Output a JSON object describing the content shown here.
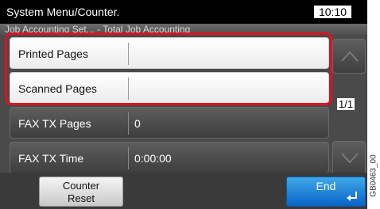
{
  "header": {
    "title": "System Menu/Counter.",
    "time": "10:10"
  },
  "breadcrumb": "Job Accounting Set... - Total Job Accounting",
  "rows": [
    {
      "label": "Printed Pages",
      "value": ""
    },
    {
      "label": "Scanned Pages",
      "value": ""
    },
    {
      "label": "FAX TX Pages",
      "value": "0"
    },
    {
      "label": "FAX TX Time",
      "value": "0:00:00"
    }
  ],
  "pagination": {
    "indicator": "1/1"
  },
  "buttons": {
    "counter_reset_line1": "Counter",
    "counter_reset_line2": "Reset",
    "end": "End"
  },
  "figure_code": "GB0463_00",
  "icons": {
    "scroll_up": "chevron-up-icon",
    "scroll_down": "chevron-down-icon",
    "end_enter": "enter-arrow-icon"
  },
  "colors": {
    "highlight_border": "#e01020",
    "end_button": "#0a64c8"
  }
}
